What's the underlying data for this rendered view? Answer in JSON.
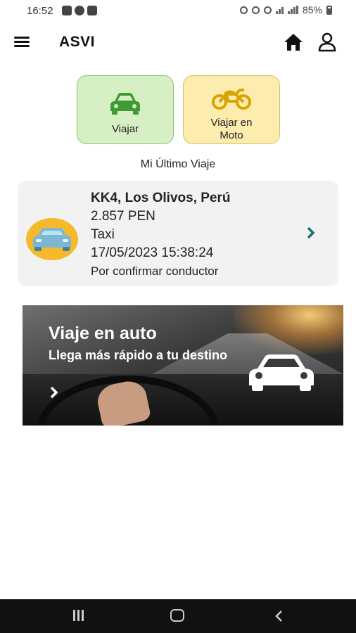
{
  "status_bar": {
    "time": "16:52",
    "battery": "85%"
  },
  "app_bar": {
    "title": "ASVI"
  },
  "trip_options": [
    {
      "label_line1": "Viajar",
      "label_line2": "",
      "icon": "car-icon",
      "color": "#d6efc4"
    },
    {
      "label_line1": "Viajar en",
      "label_line2": "Moto",
      "icon": "motorcycle-icon",
      "color": "#fcecae"
    }
  ],
  "last_trip": {
    "heading": "Mi Último Viaje",
    "address": "KK4, Los Olivos, Perú",
    "price": "2.857 PEN",
    "service": "Taxi",
    "datetime": "17/05/2023 15:38:24",
    "status": "Por confirmar conductor"
  },
  "banner": {
    "title": "Viaje en auto",
    "subtitle": "Llega más rápido a tu destino"
  },
  "colors": {
    "car_green": "#3e9a32",
    "moto_yellow": "#d9a400",
    "avatar_orange": "#f6b92b",
    "chevron_teal": "#1e6e6e"
  }
}
